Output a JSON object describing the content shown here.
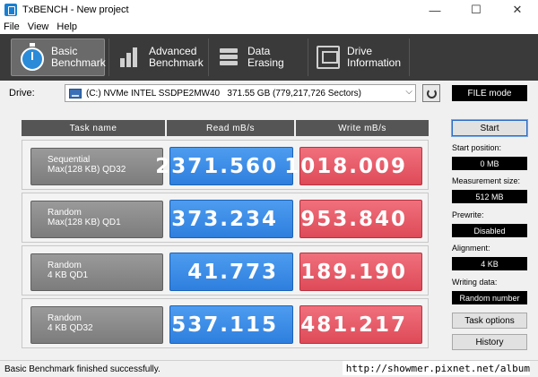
{
  "window": {
    "title": "TxBENCH - New project",
    "controls": [
      "—",
      "☐",
      "✕"
    ]
  },
  "menu": [
    "File",
    "View",
    "Help"
  ],
  "toolbar": [
    {
      "label": "Basic\nBenchmark",
      "icon": "stopwatch-icon",
      "active": true
    },
    {
      "label": "Advanced\nBenchmark",
      "icon": "bar-chart-icon",
      "active": false
    },
    {
      "label": "Data Erasing",
      "icon": "erase-icon",
      "active": false
    },
    {
      "label": "Drive\nInformation",
      "icon": "drive-info-icon",
      "active": false
    }
  ],
  "drive": {
    "label": "Drive:",
    "selected": "(C:) NVMe INTEL SSDPE2MW40   371.55 GB (779,217,726 Sectors)",
    "mode": "FILE mode"
  },
  "table": {
    "headers": [
      "Task name",
      "Read mB/s",
      "Write mB/s"
    ],
    "rows": [
      {
        "task": "Sequential\nMax(128 KB) QD32",
        "read": "2371.560",
        "write": "1018.009"
      },
      {
        "task": "Random\nMax(128 KB) QD1",
        "read": "373.234",
        "write": "953.840"
      },
      {
        "task": "Random\n4 KB QD1",
        "read": "41.773",
        "write": "189.190"
      },
      {
        "task": "Random\n4 KB QD32",
        "read": "537.115",
        "write": "481.217"
      }
    ]
  },
  "side": {
    "start_label": "Start",
    "start_position_label": "Start position:",
    "start_position_value": "0 MB",
    "measurement_size_label": "Measurement size:",
    "measurement_size_value": "512 MB",
    "prewrite_label": "Prewrite:",
    "prewrite_value": "Disabled",
    "alignment_label": "Alignment:",
    "alignment_value": "4 KB",
    "writing_data_label": "Writing data:",
    "writing_data_value": "Random number",
    "task_options_label": "Task options",
    "history_label": "History"
  },
  "status": "Basic Benchmark finished successfully.",
  "watermark": "http://showmer.pixnet.net/album",
  "colors": {
    "toolbar_bg": "#3a3a3a",
    "read_blue": "#2e7fde",
    "write_red": "#de4a58",
    "task_gray": "#8a8a8a"
  }
}
